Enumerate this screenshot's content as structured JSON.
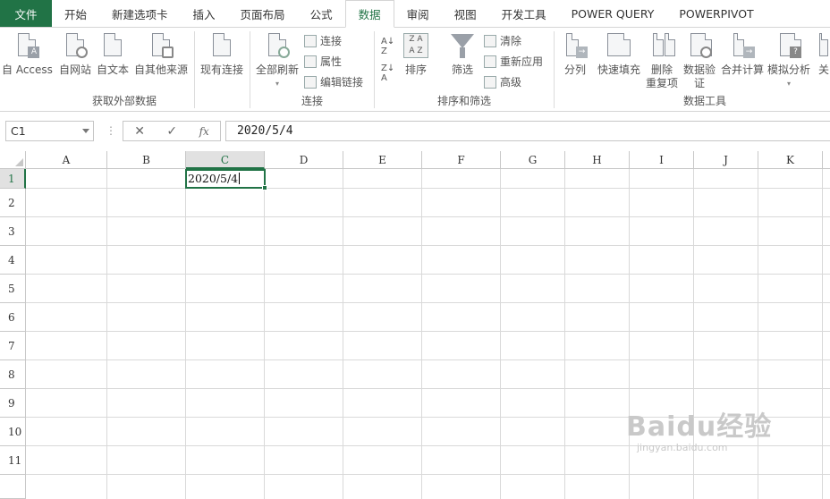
{
  "tabs": [
    "文件",
    "开始",
    "新建选项卡",
    "插入",
    "页面布局",
    "公式",
    "数据",
    "审阅",
    "视图",
    "开发工具",
    "POWER QUERY",
    "POWERPIVOT"
  ],
  "active_tab": "数据",
  "ribbon": {
    "external": {
      "label": "获取外部数据",
      "buttons": [
        "自 Access",
        "自网站",
        "自文本",
        "自其他来源",
        "现有连接"
      ]
    },
    "connections": {
      "label": "连接",
      "refresh_all": "全部刷新",
      "small": [
        "连接",
        "属性",
        "编辑链接"
      ]
    },
    "sort_filter": {
      "label": "排序和筛选",
      "sort": "排序",
      "filter": "筛选",
      "small": [
        "清除",
        "重新应用",
        "高级"
      ]
    },
    "data_tools": {
      "label": "数据工具",
      "buttons": [
        "分列",
        "快速填充",
        "删除\n重复项",
        "数据验\n证",
        "合并计算",
        "模拟分析",
        "关"
      ]
    }
  },
  "formula_bar": {
    "name_box": "C1",
    "cancel_icon": "✕",
    "enter_icon": "✓",
    "fx_label": "fx",
    "value": "2020/5/4"
  },
  "sheet": {
    "columns": [
      "A",
      "B",
      "C",
      "D",
      "E",
      "F",
      "G",
      "H",
      "I",
      "J",
      "K"
    ],
    "rows": [
      "1",
      "2",
      "3",
      "4",
      "5",
      "6",
      "7",
      "8",
      "9",
      "10",
      "11"
    ],
    "selected_column": "C",
    "selected_row": "1",
    "active_cell_value": "2020/5/4"
  },
  "watermark": {
    "brand": "Baidu经验",
    "url": "jingyan.baidu.com"
  },
  "colors": {
    "accent": "#217346",
    "grid": "#d9d9d9"
  }
}
